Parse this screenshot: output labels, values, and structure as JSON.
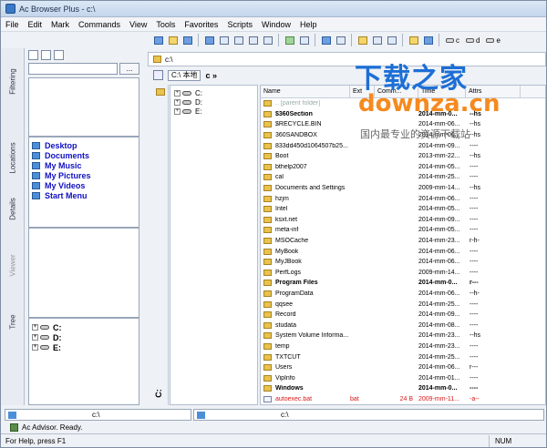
{
  "window": {
    "title": "Ac Browser Plus - c:\\"
  },
  "menu": [
    "File",
    "Edit",
    "Mark",
    "Commands",
    "View",
    "Tools",
    "Favorites",
    "Scripts",
    "Window",
    "Help"
  ],
  "toolbar": {
    "drives": [
      "c",
      "d",
      "e"
    ]
  },
  "side_tabs": [
    "Filtering",
    "Locations",
    "Details",
    "Viewer",
    "Tree"
  ],
  "left": {
    "filter_combo_value": "",
    "filter_dots": "...",
    "locations": [
      {
        "label": "Desktop",
        "icon": "desktop-icon"
      },
      {
        "label": "Documents",
        "icon": "documents-icon"
      },
      {
        "label": "My Music",
        "icon": "music-icon"
      },
      {
        "label": "My Pictures",
        "icon": "pictures-icon"
      },
      {
        "label": "My Videos",
        "icon": "videos-icon"
      },
      {
        "label": "Start Menu",
        "icon": "start-menu-icon"
      }
    ],
    "tree": [
      "C:",
      "D:",
      "E:"
    ]
  },
  "address": {
    "path": "c:\\"
  },
  "breadcrumb": {
    "combo": "C:\\ 本地",
    "next": "c »"
  },
  "mid_tree": [
    "C:",
    "D:",
    "E:"
  ],
  "mid_label": "C:",
  "columns": [
    "Name",
    "Ext",
    "Comm...",
    "Time",
    "Attrs"
  ],
  "files": [
    {
      "name": "..  [parent folder]",
      "ext": "",
      "size": "",
      "time": "",
      "attrs": "",
      "type": "parent"
    },
    {
      "name": "$360Section",
      "ext": "",
      "size": "",
      "time": "2014-mm-0...",
      "attrs": "--hs",
      "type": "folder",
      "bold": true
    },
    {
      "name": "$RECYCLE.BIN",
      "ext": "",
      "size": "",
      "time": "2014-mm-06...",
      "attrs": "--hs",
      "type": "folder"
    },
    {
      "name": "360SANDBOX",
      "ext": "",
      "size": "",
      "time": "2014-mm-06...",
      "attrs": "--hs",
      "type": "folder"
    },
    {
      "name": "833dd450d1064507b25...",
      "ext": "",
      "size": "",
      "time": "2014-mm-09...",
      "attrs": "----",
      "type": "folder"
    },
    {
      "name": "Boot",
      "ext": "",
      "size": "",
      "time": "2013-mm-22...",
      "attrs": "--hs",
      "type": "folder"
    },
    {
      "name": "bthelp2007",
      "ext": "",
      "size": "",
      "time": "2014-mm-05...",
      "attrs": "----",
      "type": "folder"
    },
    {
      "name": "cal",
      "ext": "",
      "size": "",
      "time": "2014-mm-25...",
      "attrs": "----",
      "type": "folder"
    },
    {
      "name": "Documents and Settings",
      "ext": "",
      "size": "",
      "time": "2009-mm-14...",
      "attrs": "--hs",
      "type": "folder"
    },
    {
      "name": "hzjm",
      "ext": "",
      "size": "",
      "time": "2014-mm-06...",
      "attrs": "----",
      "type": "folder"
    },
    {
      "name": "Intel",
      "ext": "",
      "size": "",
      "time": "2014-mm-05...",
      "attrs": "----",
      "type": "folder"
    },
    {
      "name": "ksxt.net",
      "ext": "",
      "size": "",
      "time": "2014-mm-09...",
      "attrs": "----",
      "type": "folder"
    },
    {
      "name": "meta-inf",
      "ext": "",
      "size": "",
      "time": "2014-mm-05...",
      "attrs": "----",
      "type": "folder"
    },
    {
      "name": "MSOCache",
      "ext": "",
      "size": "",
      "time": "2014-mm-23...",
      "attrs": "r-h-",
      "type": "folder"
    },
    {
      "name": "MyBook",
      "ext": "",
      "size": "",
      "time": "2014-mm-06...",
      "attrs": "----",
      "type": "folder"
    },
    {
      "name": "MyJBook",
      "ext": "",
      "size": "",
      "time": "2014-mm-06...",
      "attrs": "----",
      "type": "folder"
    },
    {
      "name": "PerfLogs",
      "ext": "",
      "size": "",
      "time": "2009-mm-14...",
      "attrs": "----",
      "type": "folder"
    },
    {
      "name": "Program Files",
      "ext": "",
      "size": "",
      "time": "2014-mm-0...",
      "attrs": "r---",
      "type": "folder",
      "bold": true
    },
    {
      "name": "ProgramData",
      "ext": "",
      "size": "",
      "time": "2014-mm-06...",
      "attrs": "--h-",
      "type": "folder"
    },
    {
      "name": "qqsee",
      "ext": "",
      "size": "",
      "time": "2014-mm-25...",
      "attrs": "----",
      "type": "folder"
    },
    {
      "name": "Record",
      "ext": "",
      "size": "",
      "time": "2014-mm-09...",
      "attrs": "----",
      "type": "folder"
    },
    {
      "name": "studata",
      "ext": "",
      "size": "",
      "time": "2014-mm-08...",
      "attrs": "----",
      "type": "folder"
    },
    {
      "name": "System Volume Informa...",
      "ext": "",
      "size": "",
      "time": "2014-mm-23...",
      "attrs": "--hs",
      "type": "folder"
    },
    {
      "name": "temp",
      "ext": "",
      "size": "",
      "time": "2014-mm-23...",
      "attrs": "----",
      "type": "folder"
    },
    {
      "name": "TXTCUT",
      "ext": "",
      "size": "",
      "time": "2014-mm-25...",
      "attrs": "----",
      "type": "folder"
    },
    {
      "name": "Users",
      "ext": "",
      "size": "",
      "time": "2014-mm-06...",
      "attrs": "r---",
      "type": "folder"
    },
    {
      "name": "VipInfo",
      "ext": "",
      "size": "",
      "time": "2014-mm-01...",
      "attrs": "----",
      "type": "folder"
    },
    {
      "name": "Windows",
      "ext": "",
      "size": "",
      "time": "2014-mm-0...",
      "attrs": "----",
      "type": "folder",
      "bold": true
    },
    {
      "name": "autoexec.bat",
      "ext": "bat",
      "size": "24 B",
      "time": "2009-mm-11...",
      "attrs": "-a--",
      "type": "file",
      "red": true
    }
  ],
  "path_tabs": [
    "c:\\",
    "c:\\"
  ],
  "advisor": "Ac Advisor. Ready.",
  "status": {
    "help": "For Help, press F1",
    "num": "NUM"
  },
  "watermark": {
    "cn": "下载之家",
    "en": "downza.cn",
    "sub": "国内最专业的资源下载站"
  },
  "colors": {
    "link": "#1010c0",
    "red": "#d81818",
    "wm_blue": "#1d6fd6",
    "wm_orange": "#f58a1f"
  }
}
